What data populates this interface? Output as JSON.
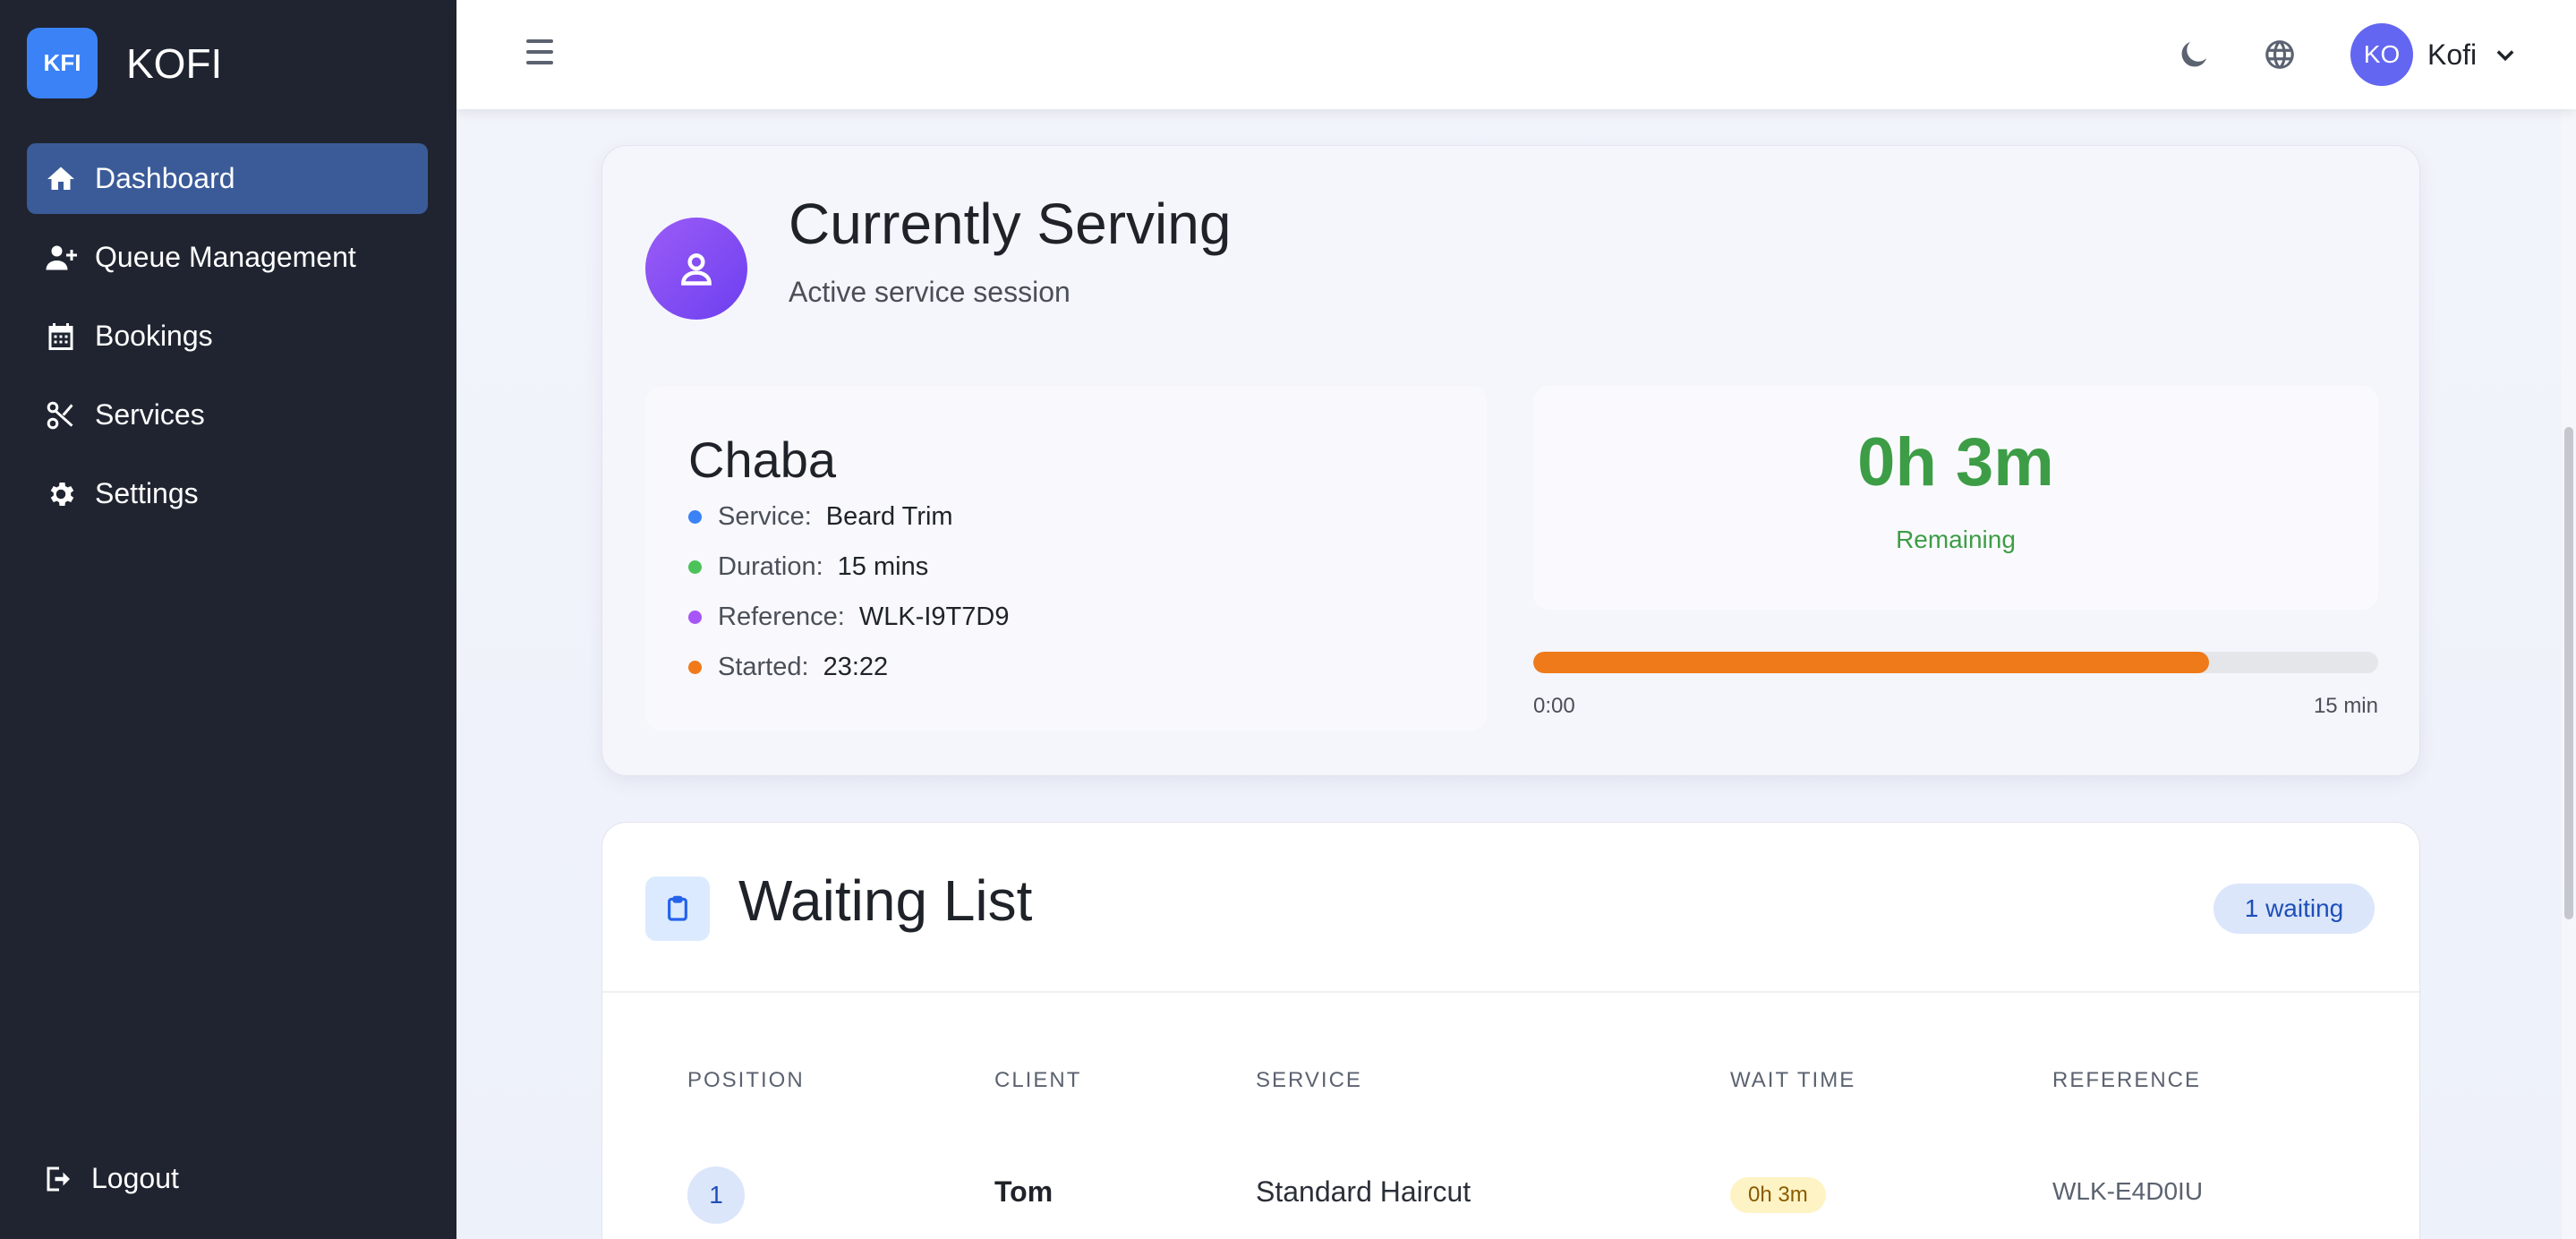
{
  "brand": {
    "logo_text": "KFI",
    "name": "KOFI"
  },
  "sidebar": {
    "items": [
      {
        "label": "Dashboard",
        "icon": "home-icon",
        "active": true
      },
      {
        "label": "Queue Management",
        "icon": "user-plus-icon",
        "active": false
      },
      {
        "label": "Bookings",
        "icon": "calendar-icon",
        "active": false
      },
      {
        "label": "Services",
        "icon": "scissors-icon",
        "active": false
      },
      {
        "label": "Settings",
        "icon": "gear-icon",
        "active": false
      }
    ],
    "logout_label": "Logout"
  },
  "header": {
    "user_initials": "KO",
    "user_name": "Kofi"
  },
  "serving": {
    "title": "Currently Serving",
    "subtitle": "Active service session",
    "client_name": "Chaba",
    "details": [
      {
        "label": "Service:",
        "value": "Beard Trim",
        "color": "#3b82f6"
      },
      {
        "label": "Duration:",
        "value": "15 mins",
        "color": "#4cc35a"
      },
      {
        "label": "Reference:",
        "value": "WLK-I9T7D9",
        "color": "#a855f7"
      },
      {
        "label": "Started:",
        "value": "23:22",
        "color": "#f07a1a"
      }
    ],
    "timer": "0h 3m",
    "timer_label": "Remaining",
    "progress_fraction": 0.8,
    "progress_start_label": "0:00",
    "progress_end_label": "15 min"
  },
  "waiting": {
    "title": "Waiting List",
    "badge": "1 waiting",
    "columns": [
      "POSITION",
      "CLIENT",
      "SERVICE",
      "WAIT TIME",
      "REFERENCE"
    ],
    "rows": [
      {
        "position": "1",
        "client": "Tom",
        "service": "Standard Haircut",
        "wait_time": "0h 3m",
        "reference": "WLK-E4D0IU"
      }
    ]
  },
  "colors": {
    "sidebar_bg": "#1f2430",
    "active_nav": "#3b5b98",
    "accent": "#3b82f6",
    "timer_green": "#3d9d46",
    "progress_orange": "#ef7a1a"
  }
}
